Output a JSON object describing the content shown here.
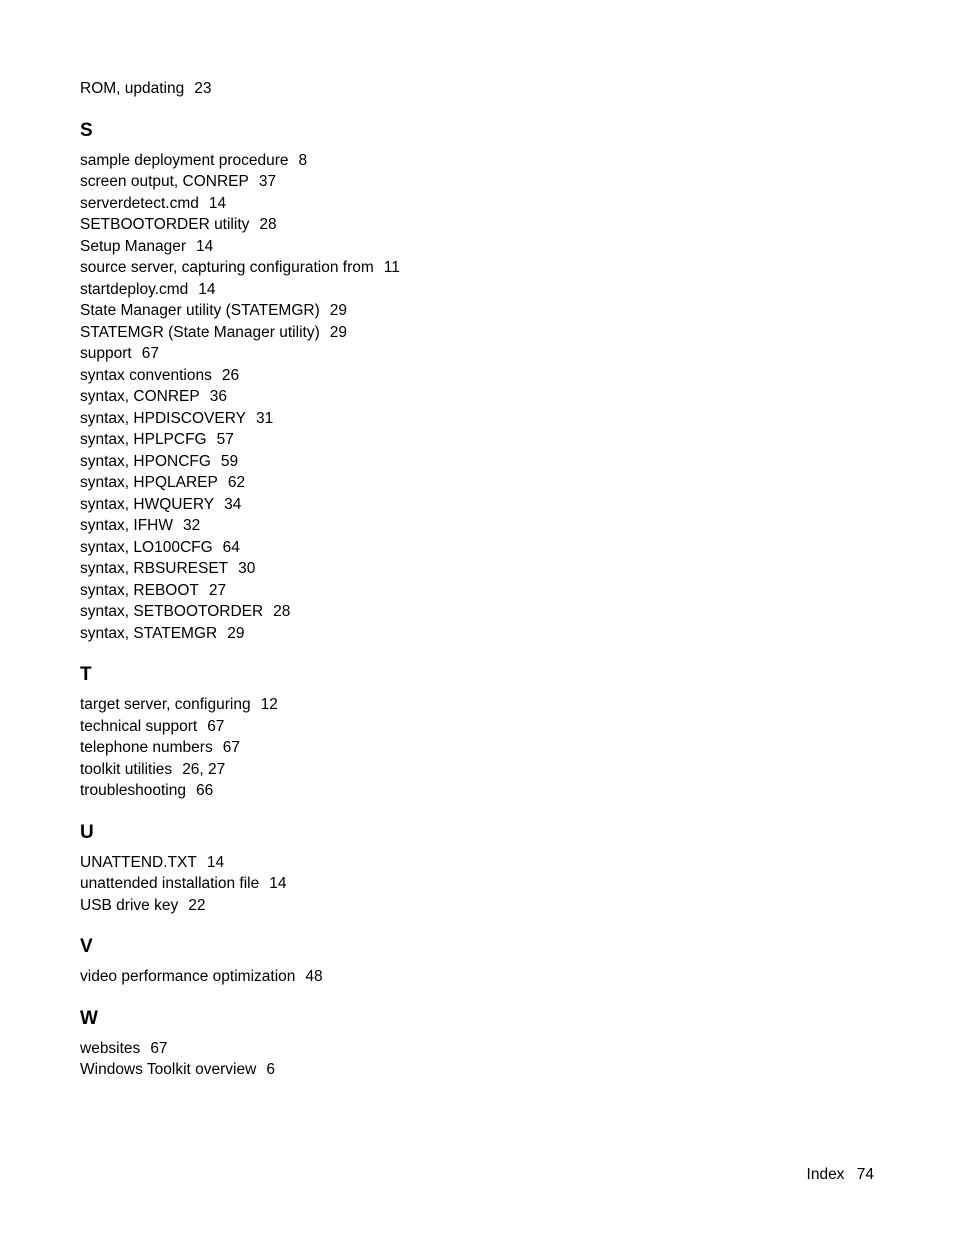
{
  "orphan_entries": [
    {
      "term": "ROM, updating",
      "pages": "23"
    }
  ],
  "sections": [
    {
      "letter": "S",
      "entries": [
        {
          "term": "sample deployment procedure",
          "pages": "8"
        },
        {
          "term": "screen output, CONREP",
          "pages": "37"
        },
        {
          "term": "serverdetect.cmd",
          "pages": "14"
        },
        {
          "term": "SETBOOTORDER utility",
          "pages": "28"
        },
        {
          "term": "Setup Manager",
          "pages": "14"
        },
        {
          "term": "source server, capturing configuration from",
          "pages": "11"
        },
        {
          "term": "startdeploy.cmd",
          "pages": "14"
        },
        {
          "term": "State Manager utility (STATEMGR)",
          "pages": "29"
        },
        {
          "term": "STATEMGR (State Manager utility)",
          "pages": "29"
        },
        {
          "term": "support",
          "pages": "67"
        },
        {
          "term": "syntax conventions",
          "pages": "26"
        },
        {
          "term": "syntax, CONREP",
          "pages": "36"
        },
        {
          "term": "syntax, HPDISCOVERY",
          "pages": "31"
        },
        {
          "term": "syntax, HPLPCFG",
          "pages": "57"
        },
        {
          "term": "syntax, HPONCFG",
          "pages": "59"
        },
        {
          "term": "syntax, HPQLAREP",
          "pages": "62"
        },
        {
          "term": "syntax, HWQUERY",
          "pages": "34"
        },
        {
          "term": "syntax, IFHW",
          "pages": "32"
        },
        {
          "term": "syntax, LO100CFG",
          "pages": "64"
        },
        {
          "term": "syntax, RBSURESET",
          "pages": "30"
        },
        {
          "term": "syntax, REBOOT",
          "pages": "27"
        },
        {
          "term": "syntax, SETBOOTORDER",
          "pages": "28"
        },
        {
          "term": "syntax, STATEMGR",
          "pages": "29"
        }
      ]
    },
    {
      "letter": "T",
      "entries": [
        {
          "term": "target server, configuring",
          "pages": "12"
        },
        {
          "term": "technical support",
          "pages": "67"
        },
        {
          "term": "telephone numbers",
          "pages": "67"
        },
        {
          "term": "toolkit utilities",
          "pages": "26, 27"
        },
        {
          "term": "troubleshooting",
          "pages": "66"
        }
      ]
    },
    {
      "letter": "U",
      "entries": [
        {
          "term": "UNATTEND.TXT",
          "pages": "14"
        },
        {
          "term": "unattended installation file",
          "pages": "14"
        },
        {
          "term": "USB drive key",
          "pages": "22"
        }
      ]
    },
    {
      "letter": "V",
      "entries": [
        {
          "term": "video performance optimization",
          "pages": "48"
        }
      ]
    },
    {
      "letter": "W",
      "entries": [
        {
          "term": "websites",
          "pages": "67"
        },
        {
          "term": "Windows Toolkit overview",
          "pages": "6"
        }
      ]
    }
  ],
  "footer": {
    "label": "Index",
    "page_number": "74"
  }
}
